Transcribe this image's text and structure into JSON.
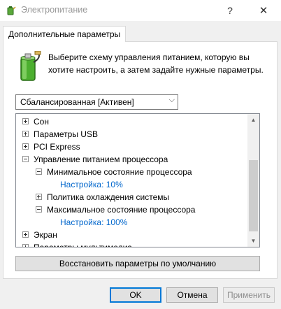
{
  "window": {
    "title": "Электропитание",
    "help_label": "?",
    "close_label": "✕"
  },
  "tab": {
    "label": "Дополнительные параметры"
  },
  "description": "Выберите схему управления питанием, которую вы хотите настроить, а затем задайте нужные параметры.",
  "scheme_select": {
    "value": "Сбалансированная [Активен]",
    "chevron": "⌵"
  },
  "tree": {
    "items": [
      {
        "label": "Сон",
        "expander": "plus"
      },
      {
        "label": "Параметры USB",
        "expander": "plus"
      },
      {
        "label": "PCI Express",
        "expander": "plus"
      },
      {
        "label": "Управление питанием процессора",
        "expander": "minus"
      },
      {
        "label": "Минимальное состояние процессора",
        "expander": "minus"
      },
      {
        "label": "Настройка: 10%",
        "expander": "none"
      },
      {
        "label": "Политика охлаждения системы",
        "expander": "plus"
      },
      {
        "label": "Максимальное состояние процессора",
        "expander": "minus"
      },
      {
        "label": "Настройка: 100%",
        "expander": "none"
      },
      {
        "label": "Экран",
        "expander": "plus"
      },
      {
        "label": "Параметры мультимедиа",
        "expander": "plus"
      }
    ],
    "scroll_up": "▲",
    "scroll_down": "▼"
  },
  "restore_button": "Восстановить параметры по умолчанию",
  "buttons": {
    "ok": "OK",
    "cancel": "Отмена",
    "apply": "Применить"
  },
  "colors": {
    "link": "#0066cc",
    "accent": "#0078d7",
    "battery_green": "#4caf2f"
  }
}
